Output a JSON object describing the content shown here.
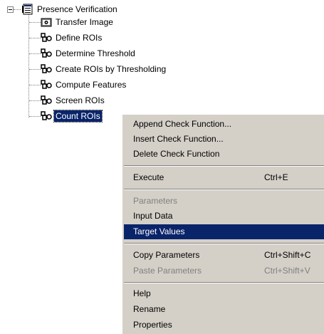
{
  "tree": {
    "root": {
      "label": "Presence Verification",
      "icon": "hierarchy-icon"
    },
    "children": [
      {
        "label": "Transfer Image",
        "icon": "camera-icon"
      },
      {
        "label": "Define ROIs",
        "icon": "step-icon"
      },
      {
        "label": "Determine Threshold",
        "icon": "step-icon"
      },
      {
        "label": "Create ROIs by Thresholding",
        "icon": "step-icon"
      },
      {
        "label": "Compute Features",
        "icon": "step-icon"
      },
      {
        "label": "Screen ROIs",
        "icon": "step-icon"
      },
      {
        "label": "Count ROIs",
        "icon": "step-icon",
        "selected": true
      }
    ]
  },
  "context_menu": {
    "items": [
      {
        "label": "Append Check Function..."
      },
      {
        "label": "Insert Check Function..."
      },
      {
        "label": "Delete Check Function"
      },
      {
        "label": "Execute",
        "shortcut": "Ctrl+E"
      },
      {
        "label": "Parameters",
        "disabled": true
      },
      {
        "label": "Input Data"
      },
      {
        "label": "Target Values",
        "highlighted": true
      },
      {
        "label": "Copy Parameters",
        "shortcut": "Ctrl+Shift+C"
      },
      {
        "label": "Paste Parameters",
        "shortcut": "Ctrl+Shift+V",
        "disabled": true
      },
      {
        "label": "Help"
      },
      {
        "label": "Rename"
      },
      {
        "label": "Properties"
      }
    ]
  },
  "colors": {
    "selection": "#0a246a",
    "menu_background": "#d4d0c8",
    "disabled_text": "#808080"
  }
}
